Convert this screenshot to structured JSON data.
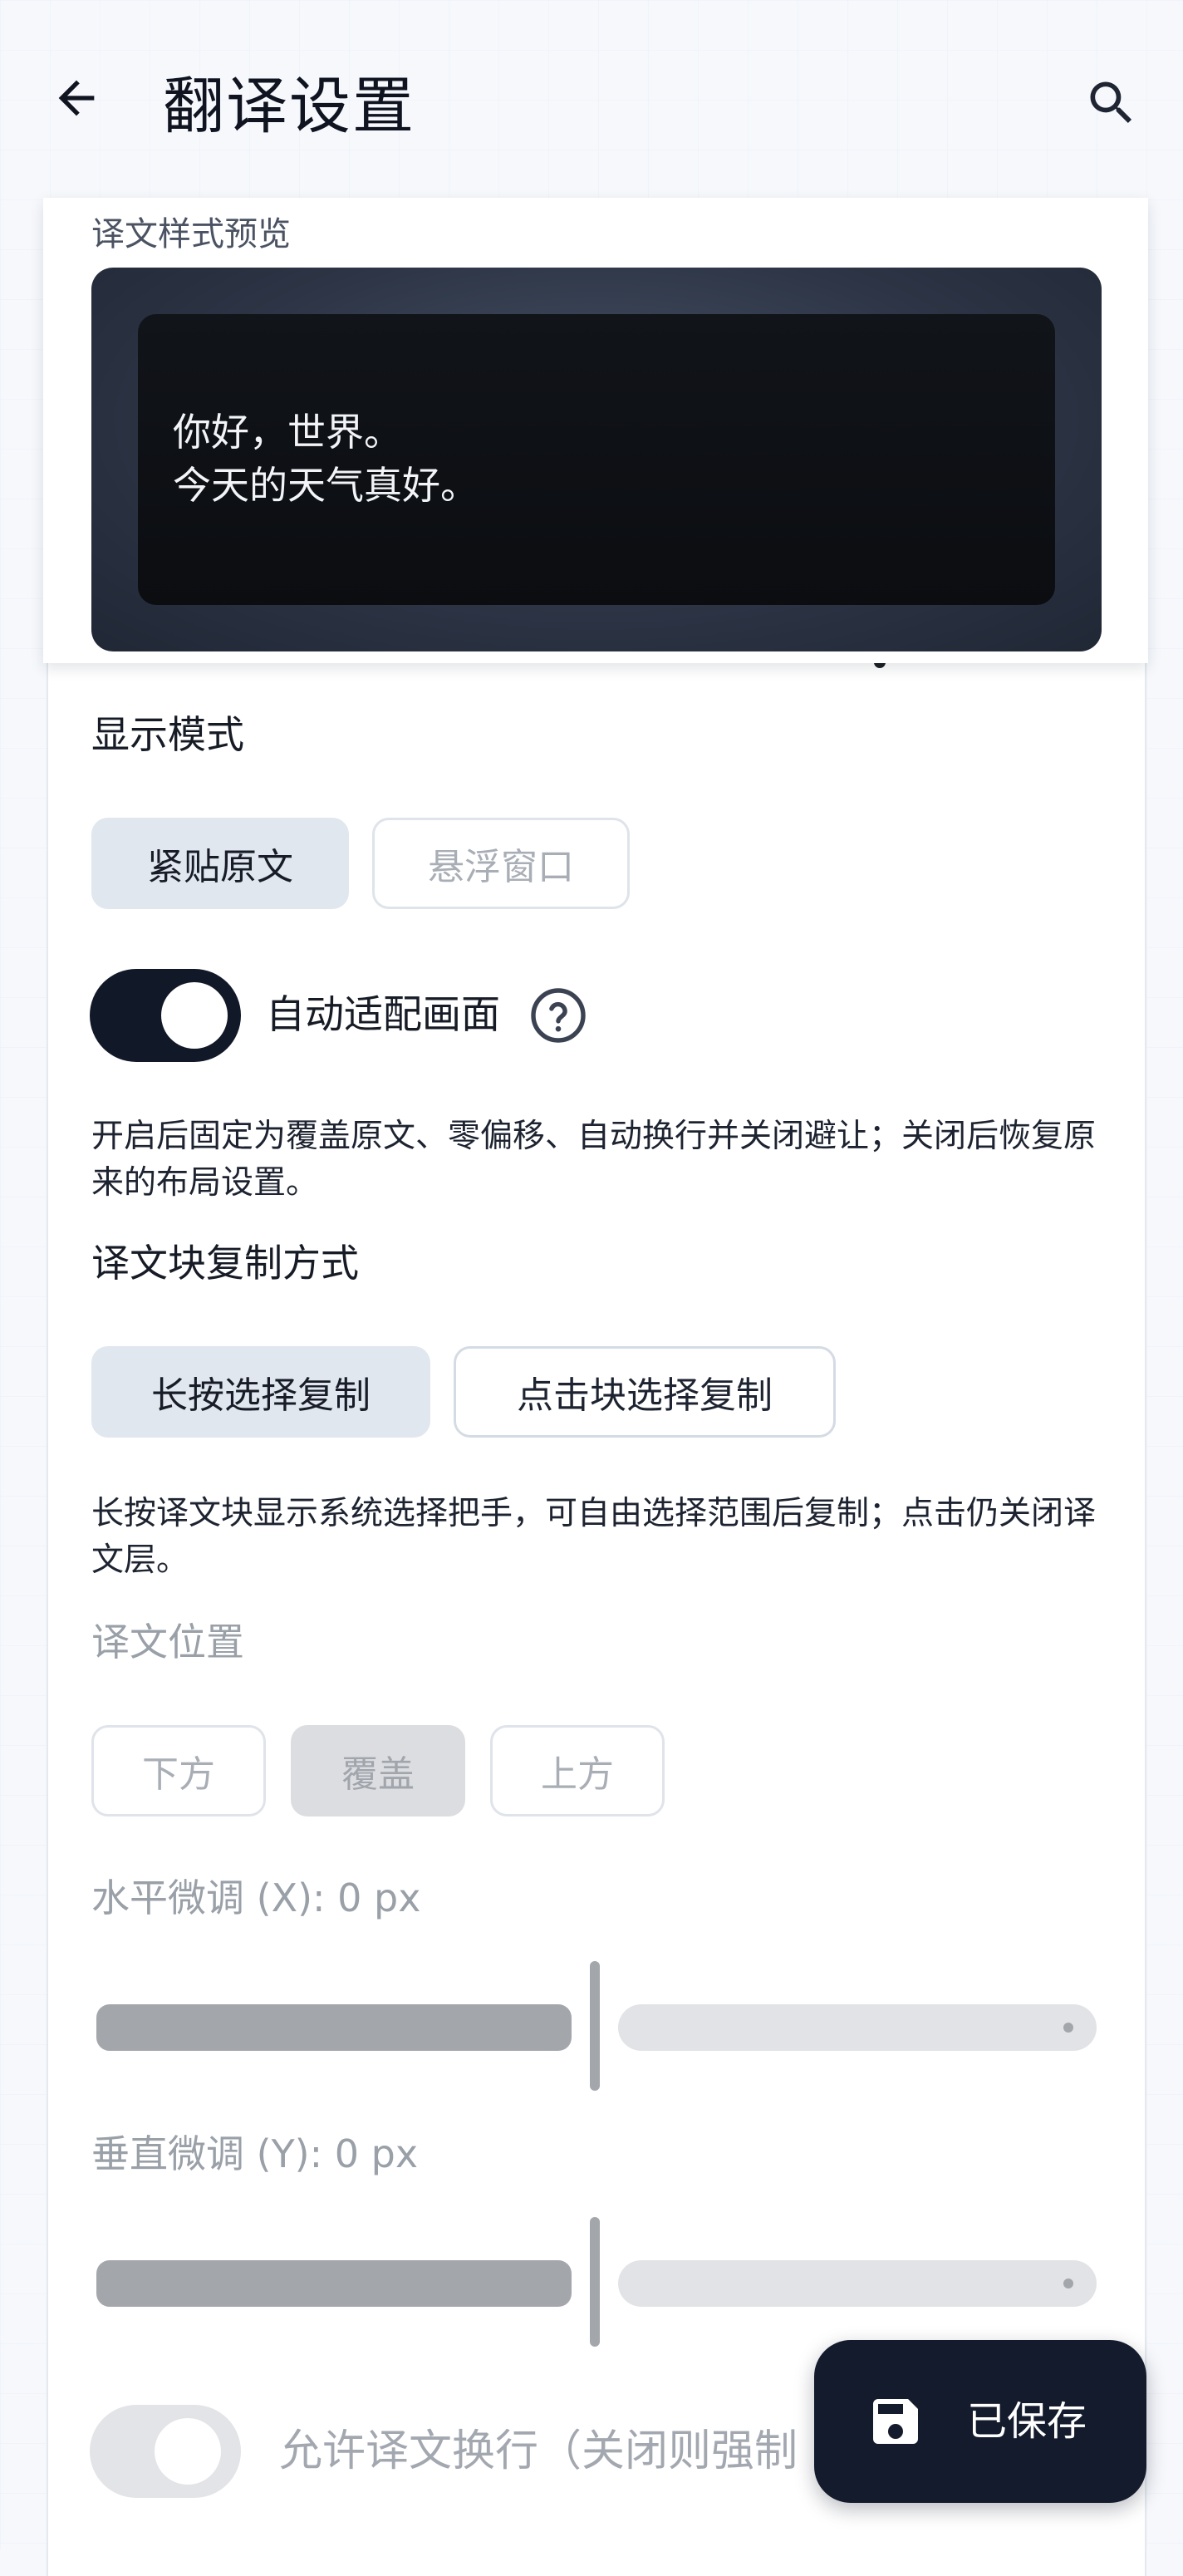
{
  "app_bar": {
    "title": "翻译设置",
    "back_icon": "arrow-left-icon",
    "search_icon": "search-icon"
  },
  "preview": {
    "label": "译文样式预览",
    "lines": [
      "你好，世界。",
      "今天的天气真好。"
    ]
  },
  "display_mode": {
    "label": "显示模式",
    "options": [
      "紧贴原文",
      "悬浮窗口"
    ],
    "selected": "紧贴原文"
  },
  "auto_fit": {
    "label": "自动适配画面",
    "enabled": true,
    "help_icon": "help-circle-icon",
    "description": "开启后固定为覆盖原文、零偏移、自动换行并关闭避让；关闭后恢复原来的布局设置。"
  },
  "copy_mode": {
    "label": "译文块复制方式",
    "options": [
      "长按选择复制",
      "点击块选择复制"
    ],
    "selected": "长按选择复制",
    "description": "长按译文块显示系统选择把手，可自由选择范围后复制；点击仍关闭译文层。"
  },
  "position": {
    "label": "译文位置",
    "options": [
      "下方",
      "覆盖",
      "上方"
    ],
    "selected": "覆盖",
    "disabled": true
  },
  "offset_x": {
    "label": "水平微调 (X): 0 px",
    "value": 0,
    "disabled": true
  },
  "offset_y": {
    "label": "垂直微调 (Y): 0 px",
    "value": 0,
    "disabled": true
  },
  "wrap": {
    "label": "允许译文换行（关闭则强制",
    "enabled": false,
    "disabled": true
  },
  "fab": {
    "label": "已保存",
    "icon": "save-icon"
  },
  "colors": {
    "accent_dark": "#111827",
    "selected_segment": "#e1e7ef",
    "disabled_text": "#9aa0a8",
    "fab_bg": "#141b2d"
  }
}
